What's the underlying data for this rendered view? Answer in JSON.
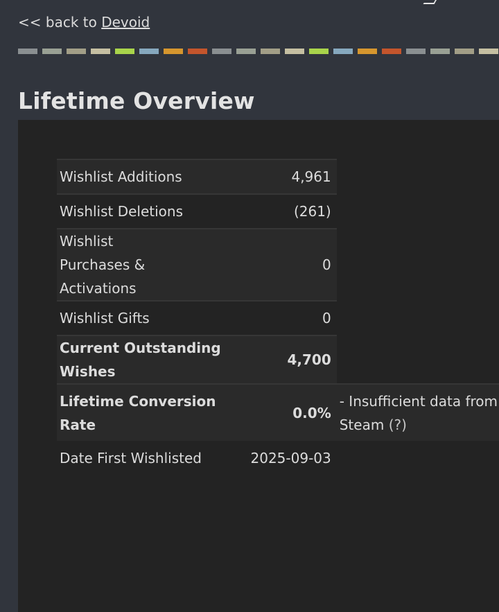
{
  "nav": {
    "back_prefix": "<< back to",
    "game_name": "Devoid"
  },
  "color_strip": [
    "#8a8f91",
    "#99a094",
    "#a29e87",
    "#c5bfa2",
    "#a9d44b",
    "#86a8be",
    "#d6962e",
    "#c4552c",
    "#8a8f91",
    "#99a094",
    "#a29e87",
    "#c5bfa2",
    "#a9d44b",
    "#86a8be",
    "#d6962e",
    "#c4552c",
    "#8a8f91",
    "#99a094",
    "#a29e87",
    "#c5bfa2"
  ],
  "section": {
    "title": "Lifetime Overview"
  },
  "stats": {
    "rows": [
      {
        "label": "Wishlist Additions",
        "value": "4,961"
      },
      {
        "label": "Wishlist Deletions",
        "value": "(261)"
      },
      {
        "label": "Wishlist Purchases & Activations",
        "value": "0"
      },
      {
        "label": "Wishlist Gifts",
        "value": "0"
      },
      {
        "label": "Current Outstanding Wishes",
        "value": "4,700"
      },
      {
        "label": "Lifetime Conversion Rate",
        "value": "0.0%",
        "note": "- Insufficient data from",
        "note_line2": "Steam",
        "note_help": "(?)"
      },
      {
        "label": "Date First Wishlisted",
        "value": "2025-09-03"
      }
    ]
  }
}
